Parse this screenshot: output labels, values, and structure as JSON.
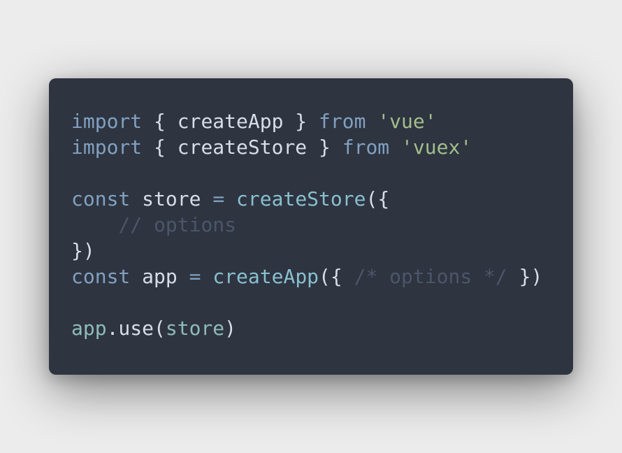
{
  "theme": {
    "background": "#ececec",
    "editor_background": "#2e3440",
    "keyword": "#81a1c1",
    "plain": "#d8dee9",
    "string": "#a3be8c",
    "function": "#88c0d0",
    "comment": "#4c566a",
    "variable": "#8fbcbb"
  },
  "code": {
    "lines": [
      [
        {
          "kind": "keyword",
          "text": "import"
        },
        {
          "kind": "plain",
          "text": " { createApp } "
        },
        {
          "kind": "keyword",
          "text": "from"
        },
        {
          "kind": "plain",
          "text": " "
        },
        {
          "kind": "string",
          "text": "'vue'"
        }
      ],
      [
        {
          "kind": "keyword",
          "text": "import"
        },
        {
          "kind": "plain",
          "text": " { createStore } "
        },
        {
          "kind": "keyword",
          "text": "from"
        },
        {
          "kind": "plain",
          "text": " "
        },
        {
          "kind": "string",
          "text": "'vuex'"
        }
      ],
      [],
      [
        {
          "kind": "keyword",
          "text": "const"
        },
        {
          "kind": "plain",
          "text": " store "
        },
        {
          "kind": "op",
          "text": "="
        },
        {
          "kind": "plain",
          "text": " "
        },
        {
          "kind": "func",
          "text": "createStore"
        },
        {
          "kind": "plain",
          "text": "({"
        }
      ],
      [
        {
          "kind": "plain",
          "text": "    "
        },
        {
          "kind": "comment",
          "text": "// options"
        }
      ],
      [
        {
          "kind": "plain",
          "text": "})"
        }
      ],
      [
        {
          "kind": "keyword",
          "text": "const"
        },
        {
          "kind": "plain",
          "text": " app "
        },
        {
          "kind": "op",
          "text": "="
        },
        {
          "kind": "plain",
          "text": " "
        },
        {
          "kind": "func",
          "text": "createApp"
        },
        {
          "kind": "plain",
          "text": "({ "
        },
        {
          "kind": "comment",
          "text": "/* options */"
        },
        {
          "kind": "plain",
          "text": " })"
        }
      ],
      [],
      [
        {
          "kind": "var",
          "text": "app"
        },
        {
          "kind": "plain",
          "text": ".use("
        },
        {
          "kind": "var",
          "text": "store"
        },
        {
          "kind": "plain",
          "text": ")"
        }
      ]
    ]
  }
}
